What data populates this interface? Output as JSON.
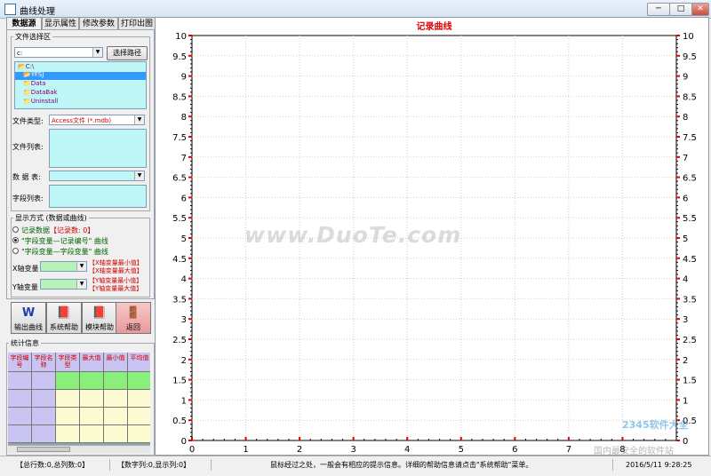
{
  "window": {
    "title": "曲线处理",
    "min": "─",
    "max": "□",
    "close": "✕"
  },
  "tabs": [
    "数据源",
    "显示属性",
    "修改参数",
    "打印出图"
  ],
  "file_group": {
    "legend": "文件选择区",
    "drive": "c:",
    "choose_path": "选择路径",
    "tree": [
      "C:\\",
      "YFSJ",
      "Data",
      "DataBak",
      "Uninstall"
    ],
    "file_type_label": "文件类型:",
    "file_type_value": "Access文件 (*.mdb)",
    "file_list_label": "文件列表:",
    "table_label": "数 据 表:",
    "field_list_label": "字段列表:"
  },
  "display_group": {
    "legend": "显示方式 (数据或曲线)",
    "options": [
      {
        "label": "记录数据",
        "extra": "【记录数: 0】",
        "selected": false
      },
      {
        "label": "\"字段变量—记录编号\" 曲线",
        "extra": "",
        "selected": true
      },
      {
        "label": "\"字段变量—字段变量\" 曲线",
        "extra": "",
        "selected": false
      }
    ],
    "x_label": "X轴变量",
    "y_label": "Y轴变量",
    "x_min": "【X轴变量最小值】",
    "x_max": "【X轴变量最大值】",
    "y_min": "【Y轴变量最小值】",
    "y_max": "【Y轴变量最大值】"
  },
  "big_buttons": [
    {
      "label": "输出曲线",
      "icon": "word-icon"
    },
    {
      "label": "系统帮助",
      "icon": "book-icon"
    },
    {
      "label": "模块帮助",
      "icon": "book-icon"
    },
    {
      "label": "返回",
      "icon": "exit-door-icon"
    }
  ],
  "stats": {
    "legend": "统计信息",
    "headers": [
      "字段编号",
      "字段名称",
      "字段类型",
      "最大值",
      "最小值",
      "平均值"
    ]
  },
  "status": {
    "rows": "【总行数:0,总列数:0】",
    "cols": "【数字列:0,显示列:0】",
    "hint": "鼠标经过之处，一般会有相应的提示信息。详细的帮助信息请点击\"系统帮助\"菜单。",
    "datetime": "2016/5/11  9:28:25"
  },
  "watermarks": {
    "main": "www.DuoTe.com",
    "logo": "2345软件大全",
    "site": "国内最安全的软件站"
  },
  "chart_data": {
    "type": "line",
    "title": "记录曲线",
    "xlim": [
      0,
      9
    ],
    "ylim": [
      0,
      10
    ],
    "x_ticks": [
      "0",
      "1",
      "2",
      "3",
      "4",
      "5",
      "6",
      "7",
      "8"
    ],
    "y_ticks": [
      "0",
      "0.5",
      "1",
      "1.5",
      "2",
      "2.5",
      "3",
      "3.5",
      "4",
      "4.5",
      "5",
      "5.5",
      "6",
      "6.5",
      "7",
      "7.5",
      "8",
      "8.5",
      "9",
      "9.5",
      "10"
    ],
    "series": [],
    "grid": true,
    "colors": {
      "title": "#e00000",
      "ticks": "#e00000"
    }
  }
}
